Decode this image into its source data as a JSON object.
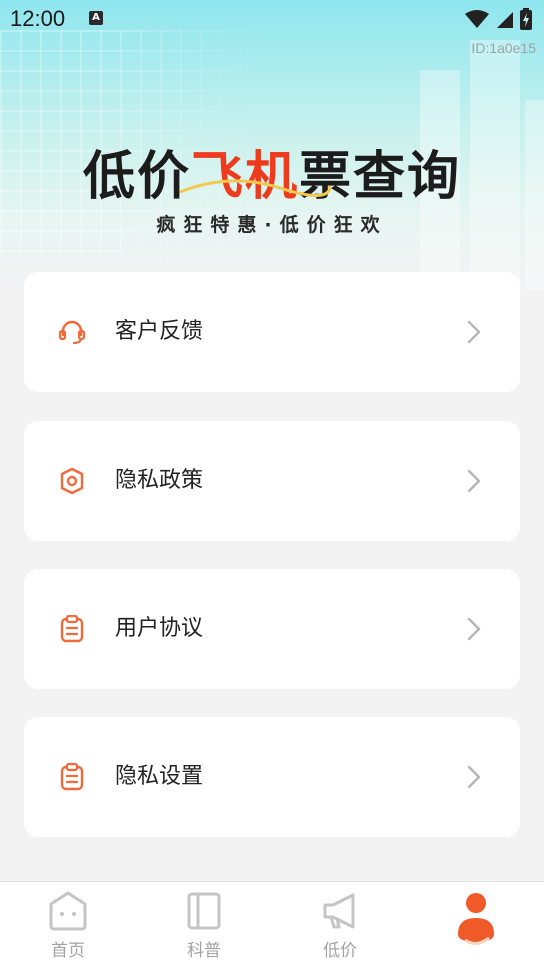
{
  "status_bar": {
    "time": "12:00",
    "badge": "A",
    "icons": [
      "wifi-icon",
      "signal-icon",
      "battery-icon"
    ]
  },
  "device_id": "ID:1a0e15",
  "banner": {
    "title_part1": "低价",
    "title_part2": "飞机",
    "title_part3": "票查询",
    "subtitle": "疯狂特惠·低价狂欢"
  },
  "menu": [
    {
      "label": "客户反馈",
      "icon": "headset-icon"
    },
    {
      "label": "隐私政策",
      "icon": "privacy-eye-icon"
    },
    {
      "label": "用户协议",
      "icon": "clipboard-icon"
    },
    {
      "label": "隐私设置",
      "icon": "clipboard-icon"
    }
  ],
  "tabs": [
    {
      "label": "首页",
      "icon": "home-icon",
      "active": false
    },
    {
      "label": "科普",
      "icon": "book-icon",
      "active": false
    },
    {
      "label": "低价",
      "icon": "megaphone-icon",
      "active": false
    },
    {
      "label": "",
      "icon": "profile-icon",
      "active": true
    }
  ],
  "colors": {
    "accent": "#f05a28",
    "icon_orange": "#f07a3c",
    "tab_inactive": "#c4c4c4"
  }
}
